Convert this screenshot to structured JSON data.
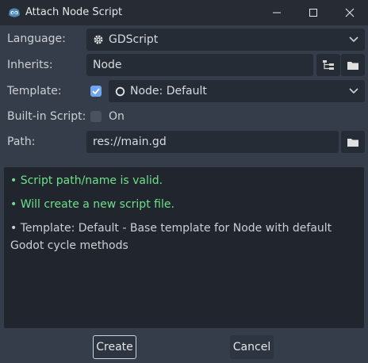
{
  "window": {
    "title": "Attach Node Script"
  },
  "form": {
    "language": {
      "label": "Language:",
      "value": "GDScript"
    },
    "inherits": {
      "label": "Inherits:",
      "value": "Node"
    },
    "template": {
      "label": "Template:",
      "enabled": true,
      "value": "Node: Default"
    },
    "builtin": {
      "label": "Built-in Script:",
      "checked": false,
      "state_label": "On"
    },
    "path": {
      "label": "Path:",
      "value": "res://main.gd"
    }
  },
  "messages": [
    {
      "text": "•  Script path/name is valid.",
      "status": "ok"
    },
    {
      "text": "•  Will create a new script file.",
      "status": "ok"
    },
    {
      "text": "•  Template: Default - Base template for Node with default Godot cycle methods",
      "status": "info"
    }
  ],
  "buttons": {
    "create": "Create",
    "cancel": "Cancel"
  },
  "colors": {
    "ok": "#6fe08a",
    "accent": "#6fa6ee",
    "background": "#363d4a",
    "field": "#262c36",
    "titlebar": "#262b34"
  }
}
